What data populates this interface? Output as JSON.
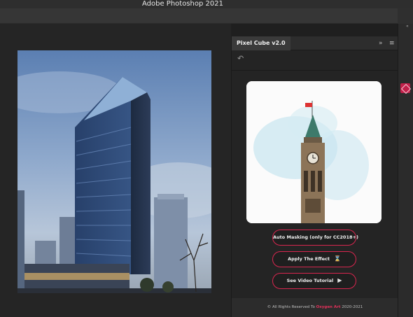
{
  "app": {
    "title": "Adobe Photoshop 2021"
  },
  "panel": {
    "tab_label": "Pixel Cube v2.0",
    "expand_glyph": "»",
    "menu_glyph": "≡",
    "back_glyph": "↶",
    "buttons": [
      {
        "label": "Auto Masking (only for CC2018+)",
        "icon": ""
      },
      {
        "label": "Apply The Effect",
        "icon": "⌛"
      },
      {
        "label": "See Video Tutorial",
        "icon": "▶"
      }
    ],
    "footer": {
      "prefix": "© All Rights Reserved To",
      "brand": "Oxygen Art",
      "years": "2020-2021"
    }
  },
  "right_strip": {
    "collapse_glyph": "«"
  },
  "colors": {
    "accent": "#d8264f",
    "brand": "#e2305a",
    "panel_bg": "#242424",
    "canvas_bg": "#252525"
  }
}
